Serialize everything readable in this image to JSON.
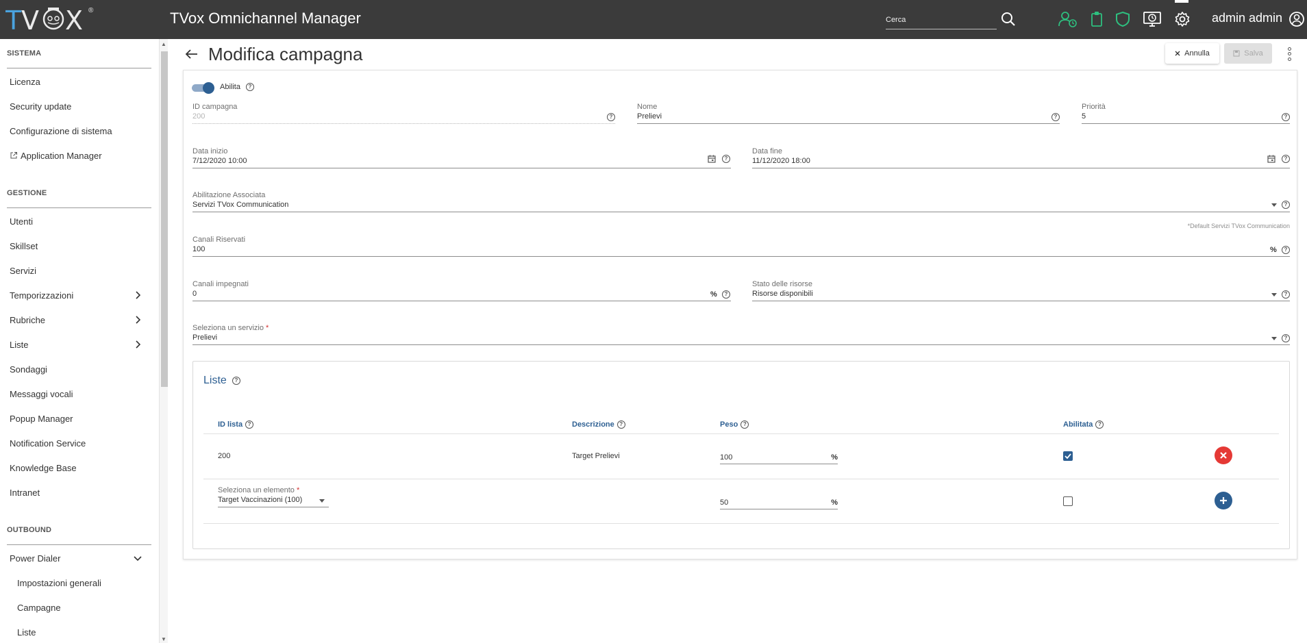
{
  "header": {
    "logo": "TVOX",
    "app_title": "TVox Omnichannel Manager",
    "search_placeholder": "Cerca",
    "user_name": "admin admin"
  },
  "sidebar": {
    "sections": [
      {
        "title": "SISTEMA"
      },
      {
        "title": "GESTIONE"
      },
      {
        "title": "OUTBOUND"
      }
    ],
    "sistema_items": [
      "Licenza",
      "Security update",
      "Configurazione di sistema",
      "Application Manager"
    ],
    "gestione_items": [
      "Utenti",
      "Skillset",
      "Servizi",
      "Temporizzazioni",
      "Rubriche",
      "Liste",
      "Sondaggi",
      "Messaggi vocali",
      "Popup Manager",
      "Notification Service",
      "Knowledge Base",
      "Intranet"
    ],
    "outbound_items": [
      "Power Dialer",
      "Impostazioni generali",
      "Campagne",
      "Liste"
    ]
  },
  "page": {
    "title": "Modifica campagna",
    "annulla_label": "Annulla",
    "salva_label": "Salva"
  },
  "form": {
    "abilita_label": "Abilita",
    "abilita_enabled": true,
    "id_campagna": {
      "label": "ID campagna",
      "value": "200"
    },
    "nome": {
      "label": "Nome",
      "value": "Prelievi"
    },
    "priorita": {
      "label": "Priorità",
      "value": "5"
    },
    "data_inizio": {
      "label": "Data inizio",
      "value": "7/12/2020 10:00"
    },
    "data_fine": {
      "label": "Data fine",
      "value": "11/12/2020 18:00"
    },
    "abilitazione": {
      "label": "Abilitazione Associata",
      "value": "Servizi TVox Communication",
      "hint": "*Default Servizi TVox Communication"
    },
    "canali_riservati": {
      "label": "Canali Riservati",
      "value": "100",
      "unit": "%"
    },
    "canali_impegnati": {
      "label": "Canali impegnati",
      "value": "0",
      "unit": "%"
    },
    "stato_risorse": {
      "label": "Stato delle risorse",
      "value": "Risorse disponibili"
    },
    "servizio": {
      "label": "Seleziona un servizio",
      "required": "*",
      "value": "Prelievi"
    }
  },
  "liste": {
    "title": "Liste",
    "columns": [
      "ID lista",
      "Descrizione",
      "Peso",
      "Abilitata"
    ],
    "rows": [
      {
        "id": "200",
        "descrizione": "Target Prelievi",
        "peso": "100",
        "unit": "%",
        "abilitata": true
      }
    ],
    "new_row": {
      "select_label": "Seleziona un elemento",
      "required": "*",
      "select_value": "Target Vaccinazioni (100)",
      "peso": "50",
      "unit": "%",
      "abilitata": false
    }
  },
  "colors": {
    "topbar": "#3b3b3b",
    "accent": "#2d5f92",
    "top_icons": "#2ebf7f",
    "delete": "#e53935"
  }
}
